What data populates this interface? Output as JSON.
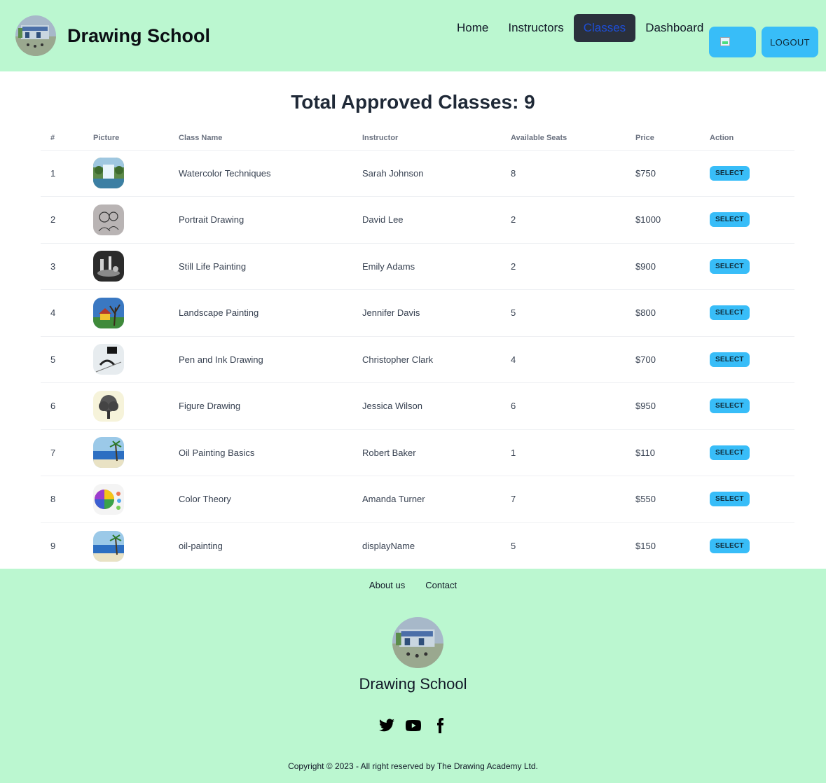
{
  "header": {
    "brand": "Drawing School",
    "nav": [
      "Home",
      "Instructors",
      "Classes",
      "Dashboard"
    ],
    "active_nav": "Classes",
    "logout_label": "LOGOUT"
  },
  "main": {
    "title": "Total Approved Classes: 9",
    "columns": [
      "#",
      "Picture",
      "Class Name",
      "Instructor",
      "Available Seats",
      "Price",
      "Action"
    ],
    "action_label": "SELECT",
    "rows": [
      {
        "num": "1",
        "thumb": "waterfall-thumbnail",
        "name": "Watercolor Techniques",
        "instructor": "Sarah Johnson",
        "seats": "8",
        "price": "$750"
      },
      {
        "num": "2",
        "thumb": "portrait-sketch-thumbnail",
        "name": "Portrait Drawing",
        "instructor": "David Lee",
        "seats": "2",
        "price": "$1000"
      },
      {
        "num": "3",
        "thumb": "still-life-thumbnail",
        "name": "Still Life Painting",
        "instructor": "Emily Adams",
        "seats": "2",
        "price": "$900"
      },
      {
        "num": "4",
        "thumb": "landscape-thumbnail",
        "name": "Landscape Painting",
        "instructor": "Jennifer Davis",
        "seats": "5",
        "price": "$800"
      },
      {
        "num": "5",
        "thumb": "ink-thumbnail",
        "name": "Pen and Ink Drawing",
        "instructor": "Christopher Clark",
        "seats": "4",
        "price": "$700"
      },
      {
        "num": "6",
        "thumb": "tree-sketch-thumbnail",
        "name": "Figure Drawing",
        "instructor": "Jessica Wilson",
        "seats": "6",
        "price": "$950"
      },
      {
        "num": "7",
        "thumb": "beach-thumbnail",
        "name": "Oil Painting Basics",
        "instructor": "Robert Baker",
        "seats": "1",
        "price": "$110"
      },
      {
        "num": "8",
        "thumb": "color-wheel-thumbnail",
        "name": "Color Theory",
        "instructor": "Amanda Turner",
        "seats": "7",
        "price": "$550"
      },
      {
        "num": "9",
        "thumb": "beach-thumbnail",
        "name": "oil-painting",
        "instructor": "displayName",
        "seats": "5",
        "price": "$150"
      }
    ]
  },
  "footer": {
    "links": [
      "About us",
      "Contact"
    ],
    "brand": "Drawing School",
    "social": [
      "twitter-icon",
      "youtube-icon",
      "facebook-icon"
    ],
    "copyright": "Copyright © 2023 - All right reserved by The Drawing Academy Ltd."
  }
}
